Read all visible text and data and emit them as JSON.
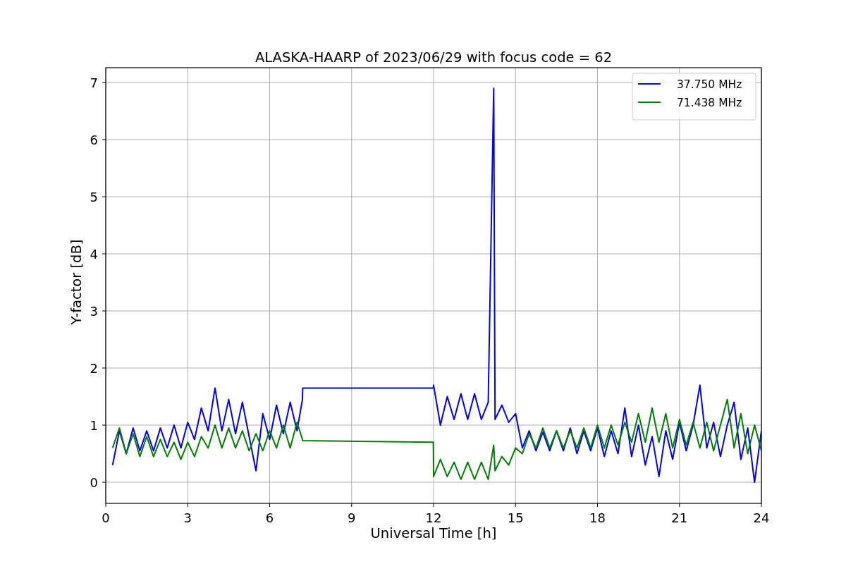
{
  "figure": {
    "chart_data": {
      "type": "line",
      "title": "ALASKA-HAARP of 2023/06/29 with focus code = 62",
      "xlabel": "Universal Time [h]",
      "ylabel": "Y-factor [dB]",
      "xlim": [
        0,
        24
      ],
      "ylim": [
        -0.37,
        7.26
      ],
      "grid": true,
      "legend": true,
      "xticks": [
        0,
        3,
        6,
        9,
        12,
        15,
        18,
        21,
        24
      ],
      "yticks": [
        0,
        1,
        2,
        3,
        4,
        5,
        6,
        7
      ],
      "x": [
        0.25,
        0.5,
        0.75,
        1.0,
        1.25,
        1.5,
        1.75,
        2.0,
        2.25,
        2.5,
        2.75,
        3.0,
        3.25,
        3.5,
        3.75,
        4.0,
        4.25,
        4.5,
        4.75,
        5.0,
        5.25,
        5.5,
        5.75,
        6.0,
        6.25,
        6.5,
        6.75,
        7.0,
        7.2,
        7.21,
        11.99,
        12.0,
        12.25,
        12.5,
        12.75,
        13.0,
        13.25,
        13.5,
        13.75,
        14.0,
        14.2,
        14.25,
        14.5,
        14.75,
        15.0,
        15.25,
        15.5,
        15.75,
        16.0,
        16.25,
        16.5,
        16.75,
        17.0,
        17.25,
        17.5,
        17.75,
        18.0,
        18.25,
        18.5,
        18.75,
        19.0,
        19.25,
        19.5,
        19.75,
        20.0,
        20.25,
        20.5,
        20.75,
        21.0,
        21.25,
        21.5,
        21.75,
        22.0,
        22.25,
        22.5,
        22.75,
        23.0,
        23.25,
        23.5,
        23.75,
        24.0
      ],
      "series": [
        {
          "name": "37.750 MHz",
          "color": "#0000ff",
          "values": [
            0.3,
            0.9,
            0.5,
            0.95,
            0.55,
            0.9,
            0.55,
            0.95,
            0.6,
            1.0,
            0.6,
            1.05,
            0.75,
            1.3,
            0.9,
            1.65,
            0.9,
            1.45,
            0.85,
            1.4,
            0.8,
            0.2,
            1.2,
            0.75,
            1.35,
            0.85,
            1.4,
            0.9,
            1.45,
            1.65,
            1.65,
            1.7,
            1.0,
            1.5,
            1.1,
            1.55,
            1.1,
            1.55,
            1.1,
            1.4,
            6.9,
            1.1,
            1.35,
            1.05,
            1.2,
            0.6,
            0.9,
            0.55,
            0.88,
            0.55,
            0.9,
            0.55,
            0.95,
            0.5,
            0.9,
            0.55,
            0.95,
            0.45,
            0.9,
            0.5,
            1.3,
            0.45,
            1.0,
            0.3,
            0.8,
            0.1,
            0.9,
            0.4,
            1.05,
            0.55,
            1.0,
            1.7,
            0.6,
            1.05,
            0.45,
            1.0,
            1.4,
            0.4,
            0.95,
            0.0,
            0.9
          ]
        },
        {
          "name": "71.438 MHz",
          "color": "#008000",
          "values": [
            0.6,
            0.95,
            0.5,
            0.85,
            0.45,
            0.8,
            0.45,
            0.75,
            0.45,
            0.7,
            0.4,
            0.7,
            0.45,
            0.8,
            0.6,
            1.0,
            0.6,
            0.95,
            0.6,
            0.9,
            0.55,
            0.85,
            0.55,
            0.9,
            0.6,
            1.0,
            0.6,
            1.05,
            0.75,
            0.73,
            0.7,
            0.1,
            0.4,
            0.1,
            0.35,
            0.05,
            0.35,
            0.05,
            0.35,
            0.05,
            0.65,
            0.2,
            0.45,
            0.3,
            0.6,
            0.5,
            0.85,
            0.6,
            0.95,
            0.6,
            0.9,
            0.6,
            0.9,
            0.6,
            0.95,
            0.6,
            1.0,
            0.6,
            1.0,
            0.65,
            1.05,
            0.7,
            1.2,
            0.7,
            1.3,
            0.7,
            1.2,
            0.6,
            1.1,
            0.65,
            1.05,
            0.6,
            1.05,
            0.55,
            1.0,
            1.45,
            0.6,
            1.2,
            0.5,
            1.0,
            0.55
          ]
        }
      ]
    }
  }
}
